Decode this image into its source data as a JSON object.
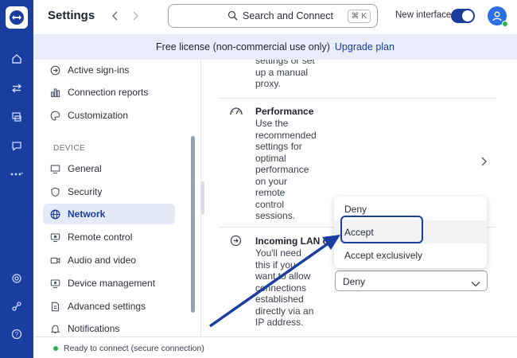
{
  "header": {
    "title": "Settings",
    "search_label": "Search and Connect",
    "search_shortcut": "⌘ K",
    "new_interface_label": "New interface",
    "new_interface_on": true
  },
  "banner": {
    "text": "Free license (non-commercial use only)",
    "link": "Upgrade plan"
  },
  "sidebar": {
    "items_top": [
      {
        "label": "Active sign-ins",
        "icon": "arrow-circle-icon"
      },
      {
        "label": "Connection reports",
        "icon": "bar-chart-icon"
      },
      {
        "label": "Customization",
        "icon": "palette-icon"
      }
    ],
    "section_device": "DEVICE",
    "items_device": [
      {
        "label": "General",
        "icon": "monitor-icon"
      },
      {
        "label": "Security",
        "icon": "shield-icon"
      },
      {
        "label": "Network",
        "icon": "globe-icon",
        "active": true
      },
      {
        "label": "Remote control",
        "icon": "remote-screen-icon"
      },
      {
        "label": "Audio and video",
        "icon": "video-icon"
      },
      {
        "label": "Device management",
        "icon": "device-gear-icon"
      },
      {
        "label": "Advanced settings",
        "icon": "document-icon"
      },
      {
        "label": "Notifications",
        "icon": "bell-icon"
      }
    ]
  },
  "main": {
    "proxy_tail": [
      "settings or set",
      "up a manual",
      "proxy."
    ],
    "performance": {
      "title": "Performance",
      "desc": [
        "Use the",
        "recommended",
        "settings for",
        "optimal",
        "performance",
        "on your",
        "remote",
        "control",
        "sessions."
      ]
    },
    "incoming_lan": {
      "title": "Incoming LAN co",
      "desc": [
        "You'll need",
        "this if you",
        "want to allow",
        "connections",
        "established",
        "directly via an",
        "IP address."
      ],
      "selected": "Deny"
    },
    "dropdown_options": [
      "Deny",
      "Accept",
      "Accept exclusively"
    ],
    "highlighted_option": "Accept"
  },
  "status": {
    "text": "Ready to connect (secure connection)",
    "color": "#2bb24c"
  },
  "colors": {
    "brand": "#1a3ea0",
    "annotation": "#1a3ea0"
  }
}
